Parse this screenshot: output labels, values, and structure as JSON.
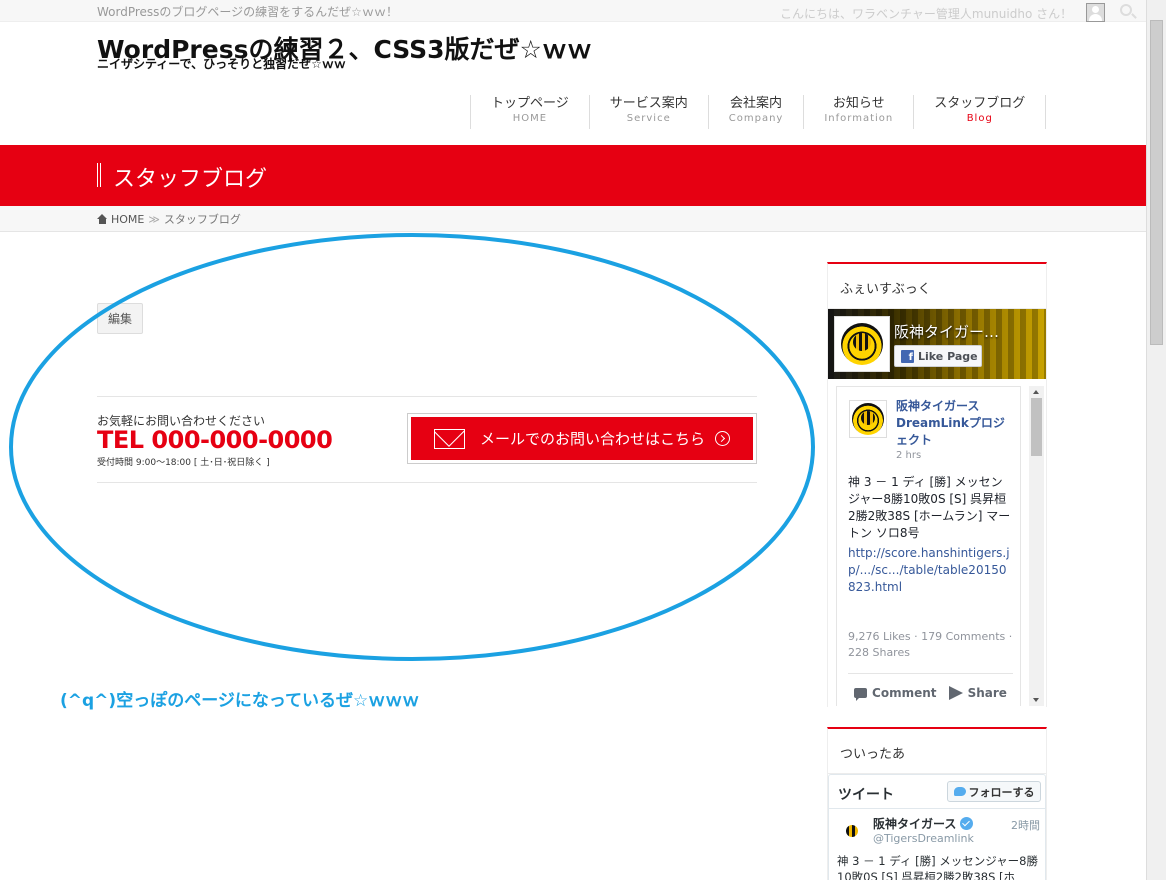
{
  "topbar": {
    "tagline": "WordPressのブログページの練習をするんだぜ☆ｗｗ！",
    "greeting": "こんにちは、ワラベンチャー管理人munuidho さん！"
  },
  "site": {
    "title": "WordPressの練習２、CSS3版だぜ☆ｗｗ",
    "description": "ニイザシティーで、ひっそりと独習だぜ☆ｗｗ"
  },
  "nav": {
    "items": [
      {
        "label": "トップページ",
        "sub": "HOME"
      },
      {
        "label": "サービス案内",
        "sub": "Service"
      },
      {
        "label": "会社案内",
        "sub": "Company"
      },
      {
        "label": "お知らせ",
        "sub": "Information"
      },
      {
        "label": "スタッフブログ",
        "sub": "Blog"
      }
    ]
  },
  "page_header": {
    "title": "スタッフブログ"
  },
  "breadcrumb": {
    "home": "HOME",
    "separator": "≫",
    "current": "スタッフブログ"
  },
  "main": {
    "edit_label": "編集",
    "contact": {
      "lead": "お気軽にお問い合わせください",
      "tel": "TEL 000-000-0000",
      "hours": "受付時間 9:00～18:00 [ 土･日･祝日除く ]",
      "button_label": "メールでのお問い合わせはこちら"
    }
  },
  "annotation": {
    "text": "(^q^)空っぽのページになっているぜ☆ｗｗｗ",
    "color": "#1ba1e2"
  },
  "sidebar": {
    "facebook": {
      "title": "ふぇいすぶっく",
      "page_name": "阪神タイガー…",
      "like_label": "Like Page",
      "post_author": "阪神タイガース DreamLinkプロジェクト",
      "post_time": "2 hrs",
      "post_text": "神 3 － 1 ディ [勝] メッセンジャー8勝10敗0S [S] 呉昇桓2勝2敗38S [ホームラン] マートン ソロ8号",
      "post_link": "http://score.hanshintigers.jp/.../sc.../table/table20150823.html",
      "stats": "9,276 Likes · 179 Comments · 228 Shares",
      "comment_label": "Comment",
      "share_label": "Share"
    },
    "twitter": {
      "title": "ついったあ",
      "header": "ツイート",
      "follow_label": "フォローする",
      "name": "阪神タイガース",
      "handle": "@TigersDreamlink",
      "time": "2時間",
      "text": "神 3 － 1 ディ [勝] メッセンジャー8勝10敗0S [S] 呉昇桓2勝2敗38S [ホ"
    }
  },
  "colors": {
    "accent": "#e60012",
    "annotation": "#1ba1e2",
    "facebook": "#4267b2",
    "twitter": "#55acee"
  }
}
